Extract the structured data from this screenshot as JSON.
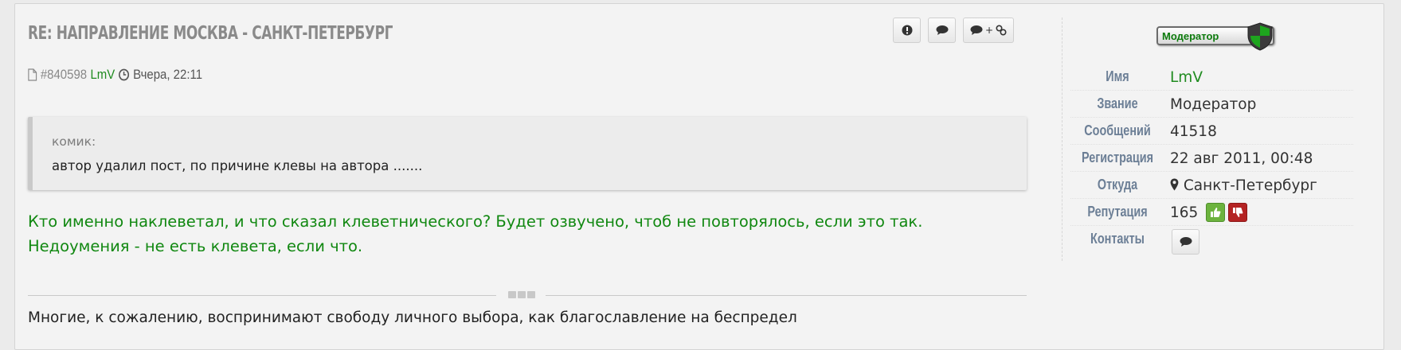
{
  "post": {
    "title": "RE: НАПРАВЛЕНИЕ МОСКВА - САНКТ-ПЕТЕРБУРГ",
    "post_number": "#840598",
    "author": "LmV",
    "date": "Вчера, 22:11",
    "tools": {
      "report_icon": "exclamation-icon",
      "reply_icon": "speech-bubble-icon",
      "multiquote_plus": "+"
    },
    "quote": {
      "author": "комик:",
      "text": "автор удалил пост, по причине клевы на автора ......."
    },
    "message_line1": "Кто именно наклеветал, и что сказал клеветнического? Будет озвучено, чтоб не повторялось, если это так.",
    "message_line2": "Недоумения - не есть клевета, если что.",
    "signature": "Многие, к сожалению, воспринимают свободу личного выбора, как благославление на беспредел"
  },
  "profile": {
    "rank_badge": "Модератор",
    "fields": {
      "name_label": "Имя",
      "name_value": "LmV",
      "rank_label": "Звание",
      "rank_value": "Модератор",
      "posts_label": "Сообщений",
      "posts_value": "41518",
      "reg_label": "Регистрация",
      "reg_value": "22 авг 2011, 00:48",
      "from_label": "Откуда",
      "from_value": "Санкт-Петербург",
      "rep_label": "Репутация",
      "rep_value": "165",
      "contacts_label": "Контакты"
    }
  },
  "colors": {
    "accent_green": "#1f8b1f",
    "message_green": "#118811",
    "label_blue_gray": "#6c7f96",
    "rep_up": "#6cb33e",
    "rep_down": "#b42323"
  }
}
